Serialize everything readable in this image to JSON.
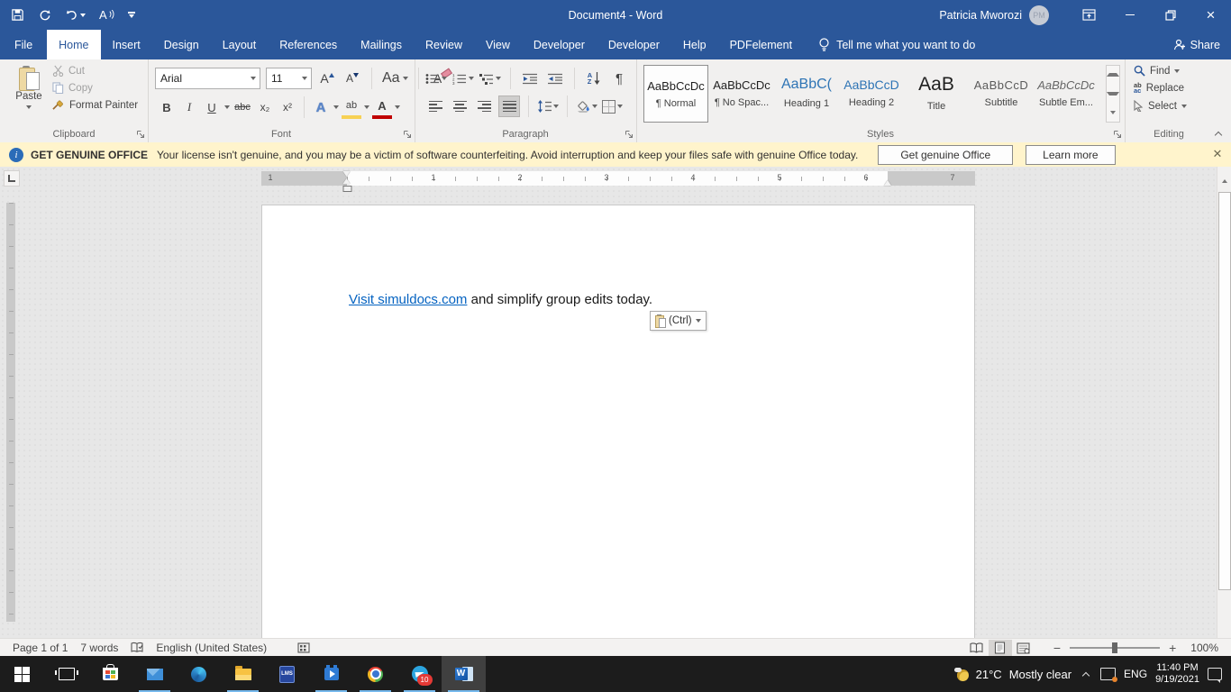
{
  "window": {
    "title": "Document4  -  Word",
    "user_name": "Patricia Mworozi",
    "user_initials": "PM"
  },
  "tabs": {
    "file": "File",
    "items": [
      "Home",
      "Insert",
      "Design",
      "Layout",
      "References",
      "Mailings",
      "Review",
      "View",
      "Developer",
      "Developer",
      "Help",
      "PDFelement"
    ]
  },
  "tell_me": "Tell me what you want to do",
  "share": "Share",
  "ribbon": {
    "clipboard": {
      "label": "Clipboard",
      "paste": "Paste",
      "cut": "Cut",
      "copy": "Copy",
      "format_painter": "Format Painter"
    },
    "font": {
      "label": "Font",
      "name": "Arial",
      "size": "11",
      "grow": "A",
      "shrink": "A",
      "change_case": "Aa",
      "clear": "A",
      "bold": "B",
      "italic": "I",
      "underline": "U",
      "strike": "abc",
      "subscript": "x₂",
      "superscript": "x²",
      "effects": "A",
      "highlight": "ab",
      "color": "A"
    },
    "paragraph": {
      "label": "Paragraph",
      "sort_a": "A",
      "sort_z": "Z",
      "pilcrow": "¶"
    },
    "styles": {
      "label": "Styles",
      "items": [
        {
          "preview": "AaBbCcDc",
          "name": "¶ Normal"
        },
        {
          "preview": "AaBbCcDc",
          "name": "¶ No Spac..."
        },
        {
          "preview": "AaBbC(",
          "name": "Heading 1"
        },
        {
          "preview": "AaBbCcD",
          "name": "Heading 2"
        },
        {
          "preview": "AaB",
          "name": "Title"
        },
        {
          "preview": "AaBbCcD",
          "name": "Subtitle"
        },
        {
          "preview": "AaBbCcDc",
          "name": "Subtle Em..."
        }
      ]
    },
    "editing": {
      "label": "Editing",
      "find": "Find",
      "replace": "Replace",
      "select": "Select",
      "replace_icon_top": "ab",
      "replace_icon_bottom": "ac"
    }
  },
  "notification": {
    "heading": "GET GENUINE OFFICE",
    "message": "Your license isn't genuine, and you may be a victim of software counterfeiting. Avoid interruption and keep your files safe with genuine Office today.",
    "primary_button": "Get genuine Office",
    "secondary_button": "Learn more"
  },
  "ruler": {
    "left_margin_number": "1",
    "numbers": [
      "1",
      "2",
      "3",
      "4",
      "5",
      "6"
    ],
    "right_margin_number": "7"
  },
  "document": {
    "link_text": "Visit simuldocs.com",
    "body_text": " and simplify group edits today.",
    "paste_options_label": "(Ctrl)"
  },
  "status_bar": {
    "page_info": "Page 1 of 1",
    "word_count": "7 words",
    "language": "English (United States)",
    "zoom_level": "100%"
  },
  "taskbar": {
    "lms_label": "LMS",
    "word_label": "W",
    "telegram_badge": "10",
    "weather_temp": "21°C",
    "weather_desc": "Mostly clear",
    "input_language": "ENG",
    "time": "11:40 PM",
    "date": "9/19/2021"
  },
  "colors": {
    "title_blue": "#2b579a",
    "link_blue": "#0563c1",
    "heading_blue": "#2e74b5",
    "message_yellow": "#fff4cc",
    "taskbar_dark": "#1c1c1c"
  }
}
